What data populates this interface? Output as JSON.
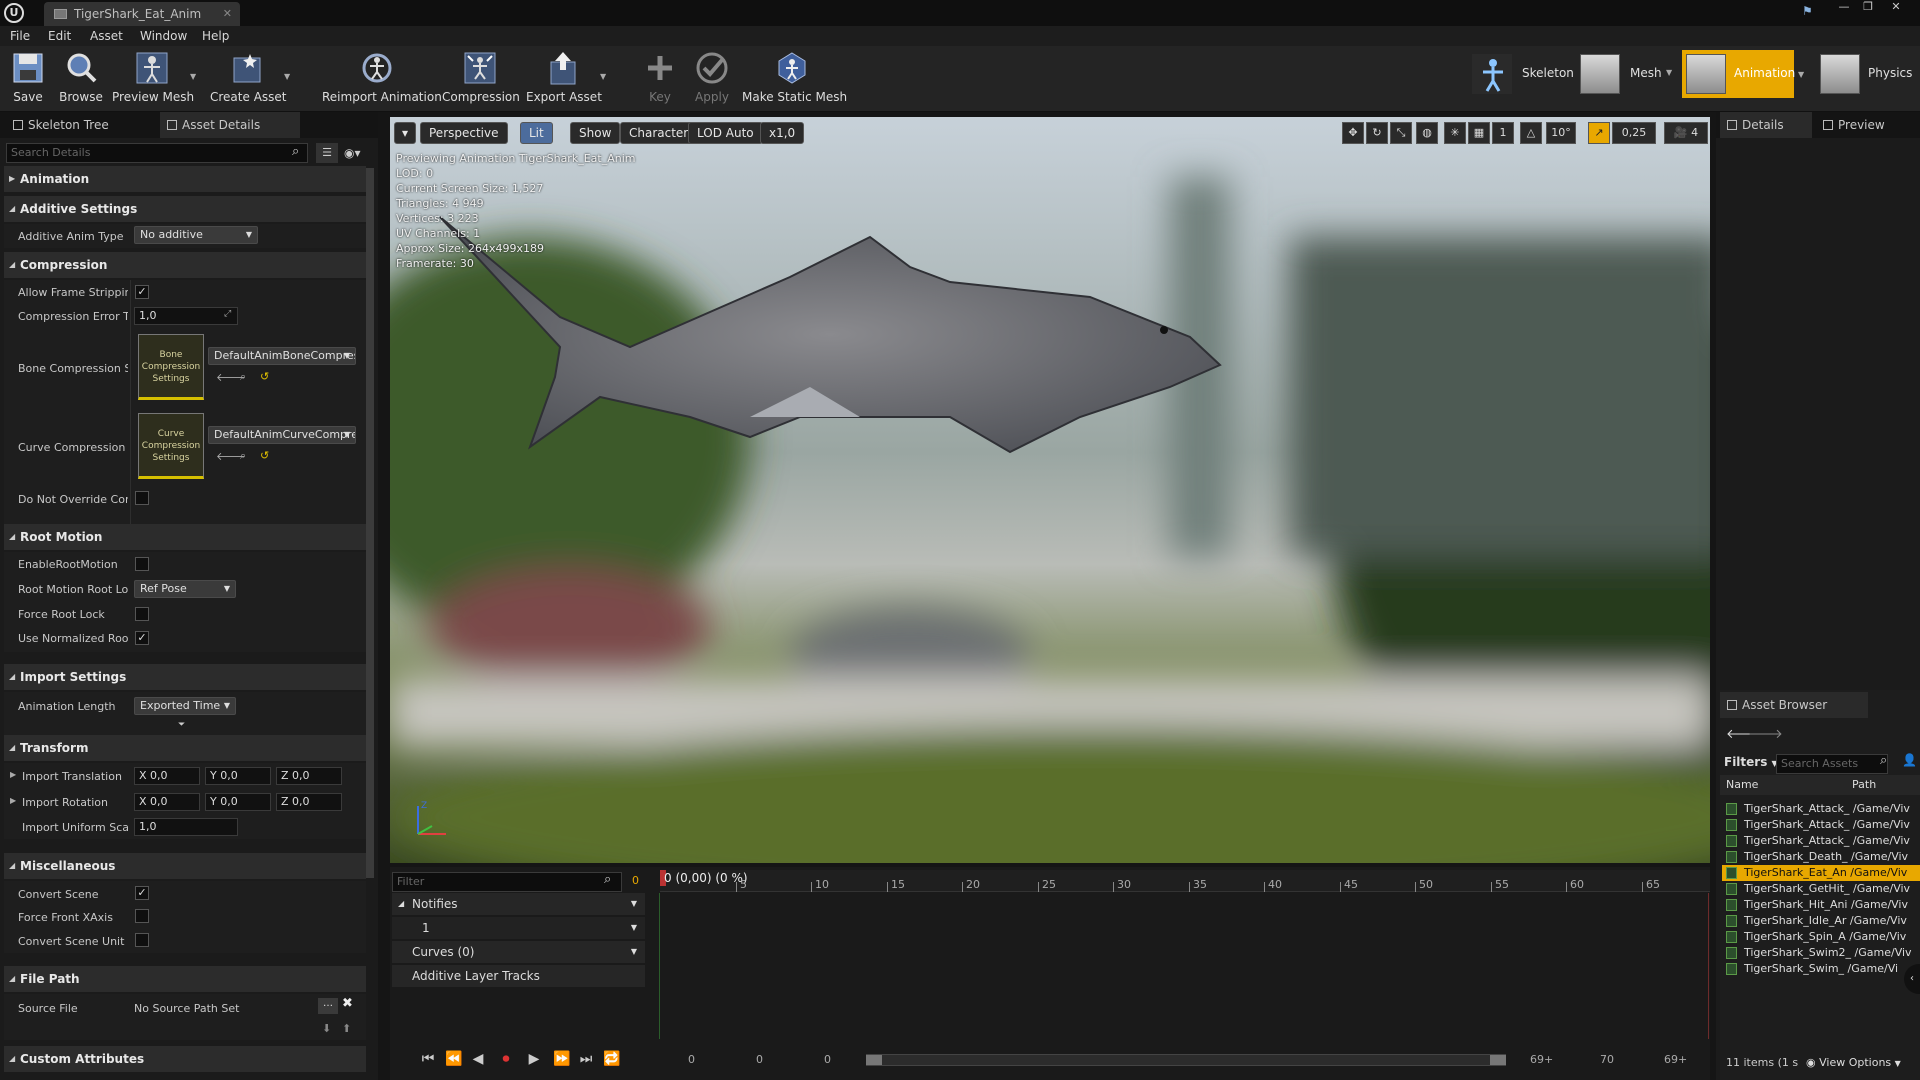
{
  "window": {
    "tab_title": "TigerShark_Eat_Anim",
    "logo": "U"
  },
  "menu": [
    "File",
    "Edit",
    "Asset",
    "Window",
    "Help"
  ],
  "toolbar": {
    "save": "Save",
    "browse": "Browse",
    "preview_mesh": "Preview Mesh",
    "create_asset": "Create Asset",
    "reimport": "Reimport Animation",
    "compression": "Compression",
    "export": "Export Asset",
    "key": "Key",
    "apply": "Apply",
    "make_static": "Make Static Mesh",
    "modes": {
      "skeleton": "Skeleton",
      "mesh": "Mesh",
      "animation": "Animation",
      "physics": "Physics"
    }
  },
  "left": {
    "tabs": [
      "Skeleton Tree",
      "Asset Details"
    ],
    "search_placeholder": "Search Details",
    "categories": {
      "animation": "Animation",
      "additive": "Additive Settings",
      "compression": "Compression",
      "root_motion": "Root Motion",
      "import": "Import Settings",
      "transform": "Transform",
      "misc": "Miscellaneous",
      "file_path": "File Path",
      "custom": "Custom Attributes"
    },
    "props": {
      "additive_type_label": "Additive Anim Type",
      "additive_type_value": "No additive",
      "allow_frame_stripping": "Allow Frame Stripping",
      "compression_error": "Compression Error Th",
      "compression_error_value": "1,0",
      "bone_compression": "Bone Compression Se",
      "bone_thumb": "Bone Compression Settings",
      "bone_value": "DefaultAnimBoneCompres",
      "curve_compression": "Curve Compression S",
      "curve_thumb": "Curve Compression Settings",
      "curve_value": "DefaultAnimCurveCompre",
      "do_not_override": "Do Not Override Com",
      "enable_root_motion": "EnableRootMotion",
      "root_lock_label": "Root Motion Root Loc",
      "root_lock_value": "Ref Pose",
      "force_root_lock": "Force Root Lock",
      "use_normalized": "Use Normalized Root",
      "anim_length_label": "Animation Length",
      "anim_length_value": "Exported Time",
      "import_translation": "Import Translation",
      "import_rotation": "Import Rotation",
      "import_uniform_scale": "Import Uniform Scale",
      "uniform_scale_value": "1,0",
      "x_val": "X 0,0",
      "y_val": "Y 0,0",
      "z_val": "Z 0,0",
      "convert_scene": "Convert Scene",
      "force_front_x": "Force Front XAxis",
      "convert_scene_unit": "Convert Scene Unit",
      "source_file": "Source File",
      "source_file_value": "No Source Path Set"
    }
  },
  "viewport": {
    "buttons": {
      "perspective": "Perspective",
      "lit": "Lit",
      "show": "Show",
      "character": "Character",
      "lod": "LOD Auto",
      "speed": "x1,0"
    },
    "snap": {
      "grid": "1",
      "angle": "10°",
      "scale": "0,25",
      "cam": "4"
    },
    "stats": [
      "Previewing Animation TigerShark_Eat_Anim",
      "LOD: 0",
      "Current Screen Size: 1,527",
      "Triangles: 4 949",
      "Vertices: 3 223",
      "UV Channels: 1",
      "Approx Size: 264x499x189",
      "Framerate: 30"
    ]
  },
  "timeline": {
    "filter_placeholder": "Filter",
    "frame_count": "0",
    "current": "0 (0,00) (0 %)",
    "ticks": [
      "5",
      "10",
      "15",
      "20",
      "25",
      "30",
      "35",
      "40",
      "45",
      "50",
      "55",
      "60",
      "65"
    ],
    "tracks": {
      "notifies": "Notifies",
      "notify_track": "1",
      "curves": "Curves   (0)",
      "additive": "Additive Layer Tracks"
    },
    "range": {
      "start": "0",
      "start2": "0",
      "start3": "0",
      "end": "69+",
      "end2": "70",
      "end3": "69+"
    }
  },
  "right": {
    "tabs": [
      "Details",
      "Preview"
    ],
    "asset_browser": {
      "title": "Asset Browser",
      "filters": "Filters",
      "search_placeholder": "Search Assets",
      "col_name": "Name",
      "col_path": "Path",
      "items": [
        "TigerShark_Attack_ /Game/Viv",
        "TigerShark_Attack_ /Game/Viv",
        "TigerShark_Attack_ /Game/Viv",
        "TigerShark_Death_ /Game/Viv",
        "TigerShark_Eat_An /Game/Viv",
        "TigerShark_GetHit_ /Game/Viv",
        "TigerShark_Hit_Ani /Game/Viv",
        "TigerShark_Idle_Ar /Game/Viv",
        "TigerShark_Spin_A /Game/Viv",
        "TigerShark_Swim2_ /Game/Viv",
        "TigerShark_Swim_ /Game/Vi"
      ],
      "selected_index": 4,
      "footer": "11 items (1 s",
      "view_options": "View Options"
    }
  },
  "colors": {
    "accent": "#e8a800",
    "bg": "#151515",
    "panel": "#1b1b1b"
  }
}
